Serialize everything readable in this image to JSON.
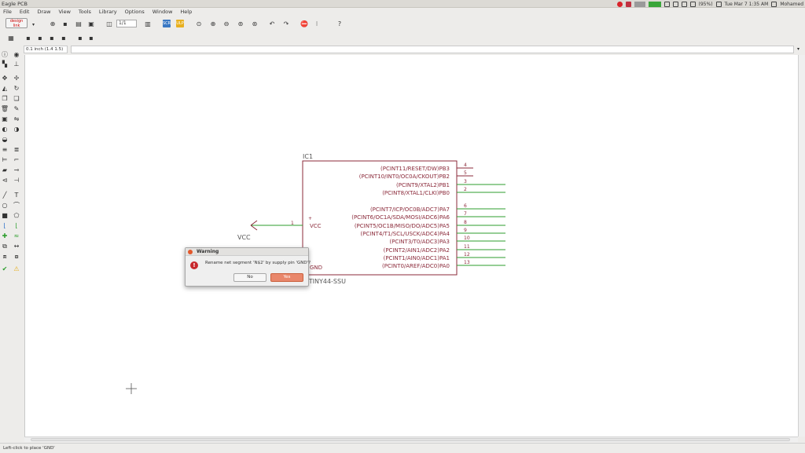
{
  "app": {
    "title": "Eagle PCB"
  },
  "tray": {
    "battery": "(95%)",
    "clock": "Tue Mar 7 1:35 AM",
    "user": "Mohamed"
  },
  "menu": [
    "File",
    "Edit",
    "Draw",
    "View",
    "Tools",
    "Library",
    "Options",
    "Window",
    "Help"
  ],
  "toolbar": {
    "brand_line1": "design",
    "brand_line2": "link",
    "page": "1/1"
  },
  "cmdbar": {
    "grid": "0.1 inch (1.4 1.5)",
    "command": ""
  },
  "schematic": {
    "part_name": "IC1",
    "part_value": "TTINY44-SSU",
    "supply_label": "VCC",
    "vcc_pin_label": "VCC",
    "gnd_pin_label": "GND",
    "vcc_pin_number": "1",
    "pins": [
      {
        "name": "(PCINT11/RESET/DW)PB3",
        "num": "4"
      },
      {
        "name": "(PCINT10/INT0/OC0A/CKOUT)PB2",
        "num": "5"
      },
      {
        "name": "(PCINT9/XTAL2)PB1",
        "num": "3"
      },
      {
        "name": "(PCINT8/XTAL1/CLKI)PB0",
        "num": "2"
      },
      {
        "name": "(PCINT7/ICP/OC0B/ADC7)PA7",
        "num": "6"
      },
      {
        "name": "(PCINT6/OC1A/SDA/MOSI/ADC6)PA6",
        "num": "7"
      },
      {
        "name": "(PCINT5/OC1B/MISO/DO/ADC5)PA5",
        "num": "8"
      },
      {
        "name": "(PCINT4/T1/SCL/USCK/ADC4)PA4",
        "num": "9"
      },
      {
        "name": "(PCINT3/T0/ADC3)PA3",
        "num": "10"
      },
      {
        "name": "(PCINT2/AIN1/ADC2)PA2",
        "num": "11"
      },
      {
        "name": "(PCINT1/AIN0/ADC1)PA1",
        "num": "12"
      },
      {
        "name": "(PCINT0/AREF/ADC0)PA0",
        "num": "13"
      }
    ]
  },
  "dialog": {
    "title": "Warning",
    "message": "Rename net segment 'N$2' by supply pin 'GND'?",
    "no_label": "No",
    "yes_label": "Yes"
  },
  "status": {
    "text": "Left-click to place 'GND'"
  },
  "colors": {
    "wire": "#2e9e2e",
    "outline": "#8b2a3a",
    "pin_text": "#8b2a3a",
    "dialog_yes": "#e9876b"
  }
}
